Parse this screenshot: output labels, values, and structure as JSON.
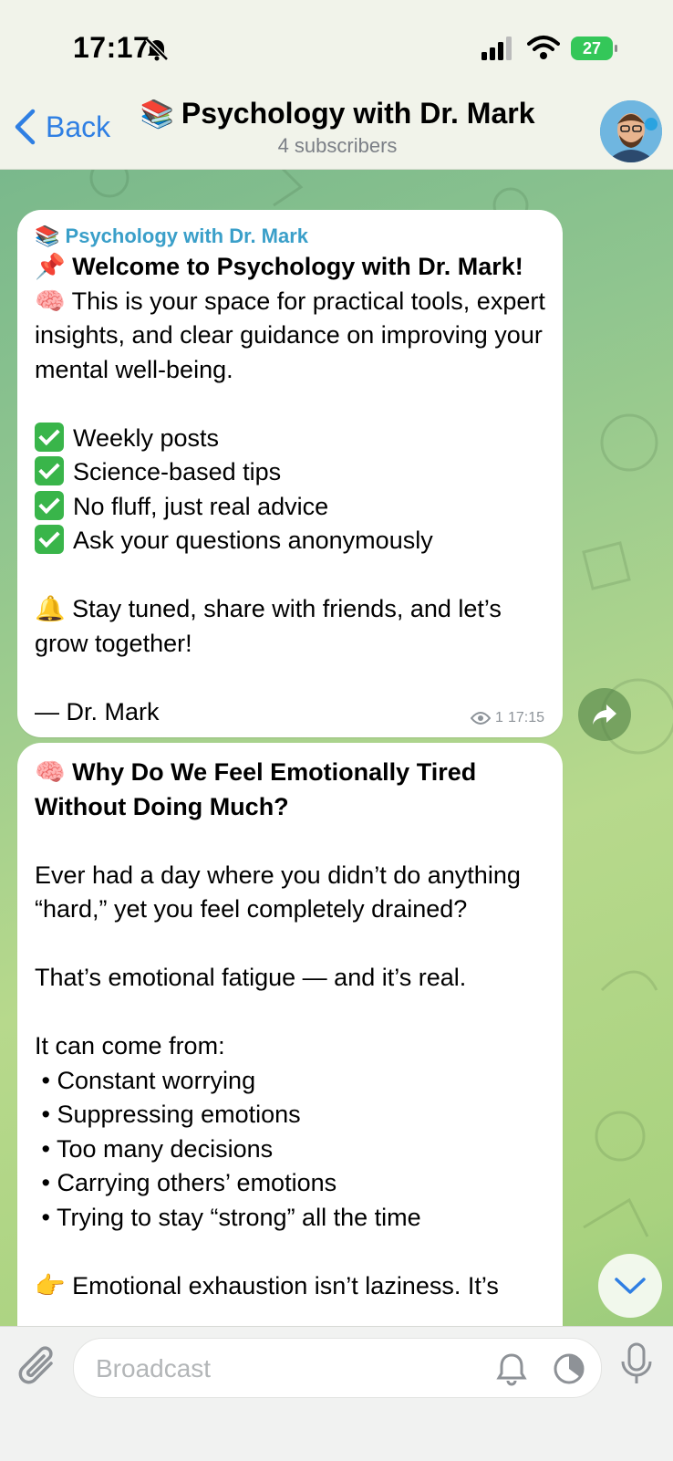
{
  "status_bar": {
    "time": "17:17",
    "battery": "27"
  },
  "header": {
    "back_label": "Back",
    "title_emoji": "📚",
    "title": "Psychology with Dr. Mark",
    "subtitle": "4 subscribers"
  },
  "messages": [
    {
      "channel_emoji": "📚",
      "channel": "Psychology with Dr. Mark",
      "title_emoji": "📌",
      "title": "Welcome to Psychology with Dr. Mark!",
      "intro": "🧠 This is your space for practical tools, expert insights, and clear guidance on improving your mental well-being.",
      "checklist": [
        "Weekly posts",
        "Science-based tips",
        "No fluff, just real advice",
        "Ask your questions anonymously"
      ],
      "closing": "🔔 Stay tuned, share with friends, and let’s grow together!",
      "signature": "— Dr. Mark",
      "views": "1",
      "time": "17:15"
    },
    {
      "title_emoji": "🧠",
      "title": "Why Do We Feel Emotionally Tired Without Doing Much?",
      "para1": "Ever had a day where you didn’t do anything “hard,” yet you feel completely drained?",
      "para2": "That’s emotional fatigue — and it’s real.",
      "list_intro": "It can come from:",
      "list": [
        "Constant worrying",
        "Suppressing emotions",
        "Too many decisions",
        "Carrying others’ emotions",
        "Trying to stay “strong” all the time"
      ],
      "last_line": "👉 Emotional exhaustion isn’t laziness. It’s"
    }
  ],
  "composer": {
    "placeholder": "Broadcast"
  },
  "icons": [
    "bell-off-icon",
    "signal-icon",
    "wifi-icon",
    "battery-icon",
    "back-chevron-icon",
    "avatar",
    "eye-icon",
    "share-icon",
    "chevron-down-icon",
    "paperclip-icon",
    "bell-icon",
    "timer-icon",
    "microphone-icon"
  ],
  "colors": {
    "accent": "#2f7fe3",
    "channel_name": "#3a9fc9",
    "battery": "#34c759"
  }
}
